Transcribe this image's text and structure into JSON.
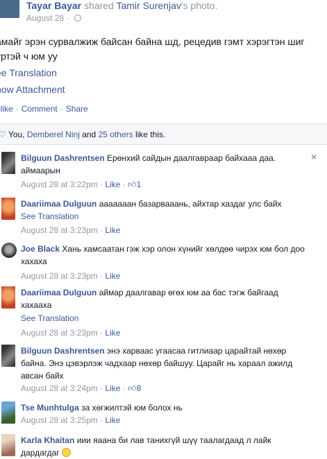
{
  "post": {
    "author": "Tayar Bayar",
    "action": "shared",
    "shared_from": "Tamir Surenjav",
    "shared_suffix": "'s photo.",
    "date": "August 28",
    "text": "амайг эрэн сурвалжиж байсан байна шд, рецедив гэмт хэрэгтэн шиг\nүртэй ч юм уу",
    "see_translation": "See Translation",
    "show_attachment": "how Attachment",
    "actions": [
      "nlike",
      "Comment",
      "Share"
    ],
    "see_translation_display": "ee Translation"
  },
  "likes": {
    "you": "You,",
    "friend": "Demberel Ninj",
    "and": "and",
    "others": "25 others",
    "suffix": "like this."
  },
  "comments": [
    {
      "name": "Bilguun Dashrentsen",
      "text": "Ерөнхий сайдын даалгавраар байхааа даа. аймаарын",
      "time": "August 28 at 3:22pm",
      "like": "Like",
      "likes": "1"
    },
    {
      "name": "Daariimaa Dulguun",
      "text": "ааааааан базарвааань, айхтар хаздаг улс байх",
      "translation": "See Translation",
      "time": "August 28 at 3:23pm",
      "like": "Like"
    },
    {
      "name": "Joe Black",
      "text": "Хань хамсаатан гэж хэр олон хүнийг хөлдөө чирэх юм бол доо хахаха",
      "time": "August 28 at 3:23pm",
      "like": "Like"
    },
    {
      "name": "Daariimaa Dulguun",
      "text": "аймар даалгавар өгөх юм аа бас тэгж байгаад хахаахa",
      "translation": "See Translation",
      "time": "August 28 at 3:23pm",
      "like": "Like"
    },
    {
      "name": "Bilguun Dashrentsen",
      "text": "энэ харваас угаасаа гитлиаар царайтай нөхөр байна. Энэ цэвэрлэж чадхаар нөхөр байшуу. Царайг нь хараал ажилд авсан байх",
      "time": "August 28 at 3:24pm",
      "like": "Like",
      "likes": "8"
    },
    {
      "name": "Tse Munhtulga",
      "text": "за хөгжилтэй юм болох нь",
      "time": "August 28 at 3:25pm",
      "like": "Like"
    },
    {
      "name": "Karla Khaitan",
      "text": "иии яаана би лав танихгүй шүү таалагдаад л лайк дардагдаг"
    }
  ],
  "colors": {
    "link": "#3b5998",
    "muted": "#9197a3",
    "text": "#141823"
  },
  "icons": [
    "globe-icon",
    "thumbs-up-icon",
    "close-icon",
    "heart-icon",
    "smile-emoji-icon"
  ]
}
